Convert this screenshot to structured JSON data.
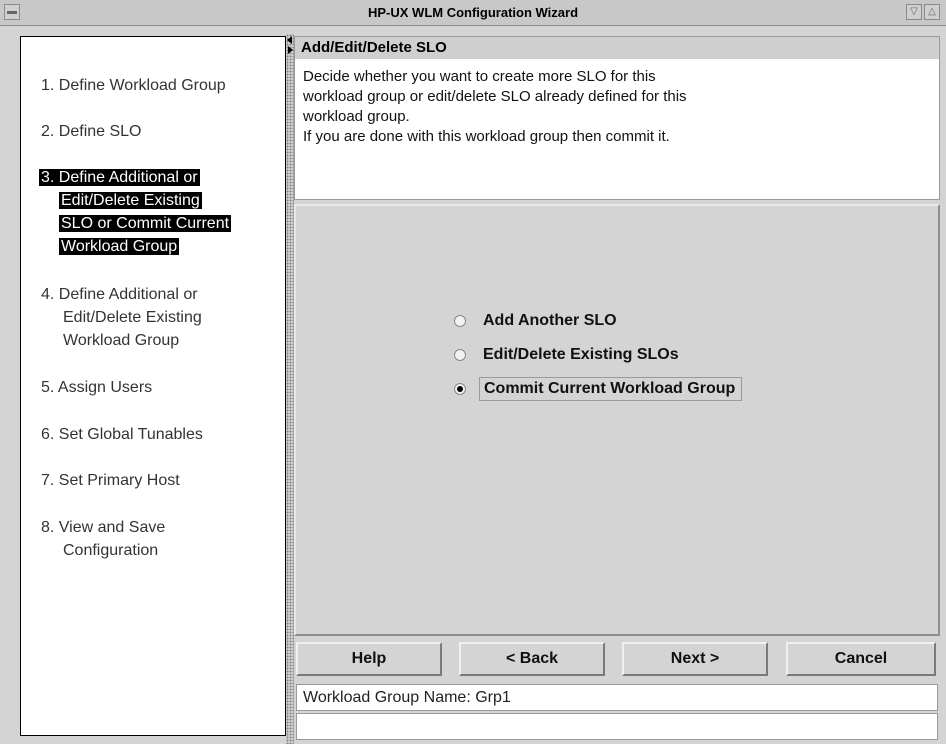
{
  "window": {
    "title": "HP-UX WLM Configuration Wizard"
  },
  "steps": [
    {
      "label": "1. Define Workload Group"
    },
    {
      "label": "2. Define SLO"
    },
    {
      "lines": [
        "3. Define Additional or",
        "Edit/Delete Existing",
        "SLO or Commit Current",
        "Workload Group"
      ]
    },
    {
      "lines": [
        "4. Define Additional or",
        "Edit/Delete Existing",
        "Workload Group"
      ]
    },
    {
      "label": "5. Assign Users"
    },
    {
      "label": "6. Set Global Tunables"
    },
    {
      "label": "7. Set Primary Host"
    },
    {
      "lines": [
        "8. View and Save",
        "Configuration"
      ]
    }
  ],
  "panel": {
    "header": "Add/Edit/Delete SLO",
    "description": [
      "Decide whether you want to create more SLO for this",
      "workload group or edit/delete SLO already defined for this",
      "workload group.",
      "If you are done with this workload group then commit it."
    ]
  },
  "options": [
    {
      "label": "Add Another SLO",
      "selected": false
    },
    {
      "label": "Edit/Delete Existing SLOs",
      "selected": false
    },
    {
      "label": "Commit Current Workload Group",
      "selected": true
    }
  ],
  "buttons": {
    "help": "Help",
    "back": "< Back",
    "next": "Next >",
    "cancel": "Cancel"
  },
  "status": {
    "workload_group_name": "Workload Group Name: Grp1",
    "message": ""
  }
}
